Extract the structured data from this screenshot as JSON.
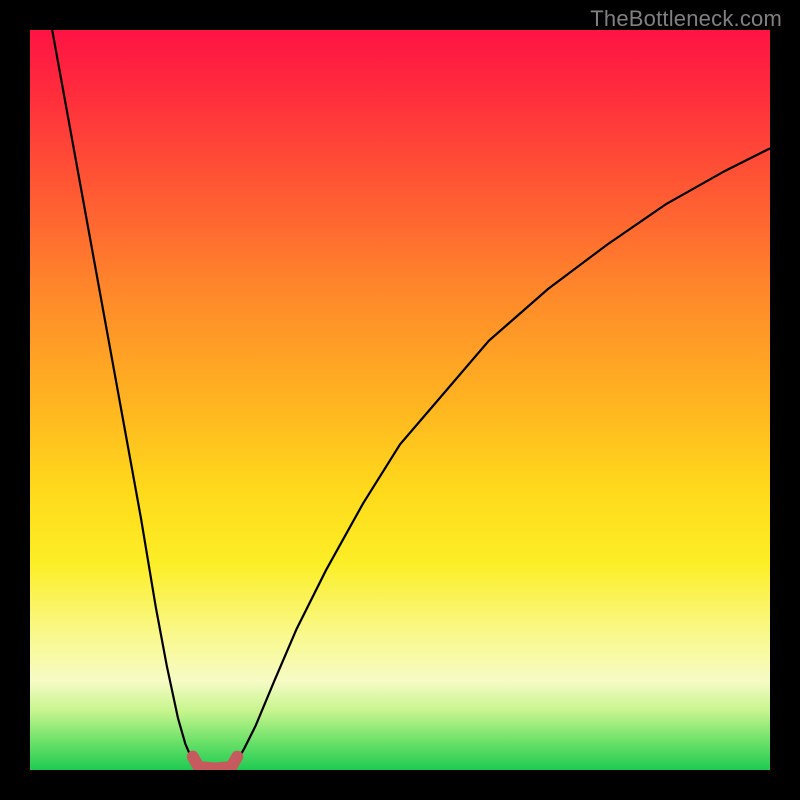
{
  "watermark": "TheBottleneck.com",
  "chart_data": {
    "type": "line",
    "title": "",
    "xlabel": "",
    "ylabel": "",
    "xlim": [
      0,
      100
    ],
    "ylim": [
      0,
      100
    ],
    "grid": false,
    "legend": false,
    "annotations": [],
    "series": [
      {
        "name": "left-branch",
        "stroke": "#000000",
        "stroke_width": 2.2,
        "x": [
          3,
          5,
          7,
          9,
          11,
          13,
          15,
          17,
          18.5,
          20,
          21,
          22,
          22.8
        ],
        "y": [
          100,
          89,
          78,
          67,
          56,
          45,
          34,
          22,
          14,
          7,
          3.5,
          1.2,
          0.5
        ]
      },
      {
        "name": "right-branch",
        "stroke": "#000000",
        "stroke_width": 2.2,
        "x": [
          27.2,
          28,
          29,
          30.5,
          33,
          36,
          40,
          45,
          50,
          56,
          62,
          70,
          78,
          86,
          94,
          100
        ],
        "y": [
          0.5,
          1.2,
          3,
          6,
          12,
          19,
          27,
          36,
          44,
          51,
          58,
          65,
          71,
          76.5,
          81,
          84
        ]
      },
      {
        "name": "bottom-flat",
        "stroke": "#c75a5e",
        "stroke_width": 12,
        "linecap": "round",
        "x": [
          22,
          22.8,
          25,
          27.2,
          28
        ],
        "y": [
          1.8,
          0.4,
          0.2,
          0.4,
          1.8
        ]
      }
    ]
  }
}
